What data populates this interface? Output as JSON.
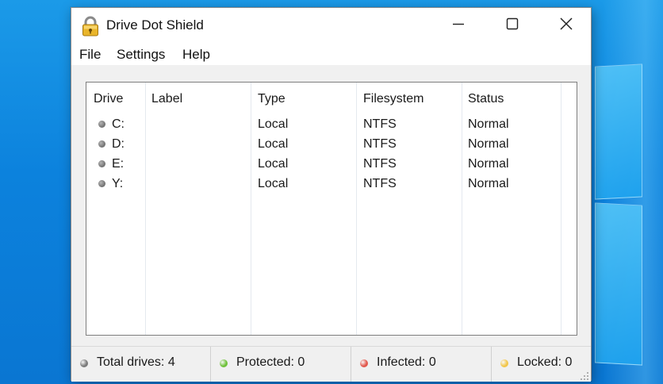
{
  "window": {
    "title": "Drive Dot Shield",
    "controls": {
      "minimize": "minimize",
      "maximize": "maximize",
      "close": "close"
    }
  },
  "menu": {
    "items": [
      "File",
      "Settings",
      "Help"
    ]
  },
  "table": {
    "columns": [
      "Drive",
      "Label",
      "Type",
      "Filesystem",
      "Status"
    ],
    "rows": [
      {
        "drive": "C:",
        "label": "",
        "type": "Local",
        "filesystem": "NTFS",
        "status": "Normal"
      },
      {
        "drive": "D:",
        "label": "",
        "type": "Local",
        "filesystem": "NTFS",
        "status": "Normal"
      },
      {
        "drive": "E:",
        "label": "",
        "type": "Local",
        "filesystem": "NTFS",
        "status": "Normal"
      },
      {
        "drive": "Y:",
        "label": "",
        "type": "Local",
        "filesystem": "NTFS",
        "status": "Normal"
      }
    ],
    "row_dot_color": "#7d7d7d"
  },
  "statusbar": {
    "total": {
      "text": "Total drives: 4",
      "color": "#7a7a7a"
    },
    "protected": {
      "text": "Protected: 0",
      "color": "#6fc13a"
    },
    "infected": {
      "text": "Infected: 0",
      "color": "#e2574c"
    },
    "locked": {
      "text": "Locked: 0",
      "color": "#f2c64a"
    }
  },
  "icons": {
    "app": "padlock-icon",
    "minimize": "minimize-icon",
    "maximize": "maximize-icon",
    "close": "close-icon"
  }
}
